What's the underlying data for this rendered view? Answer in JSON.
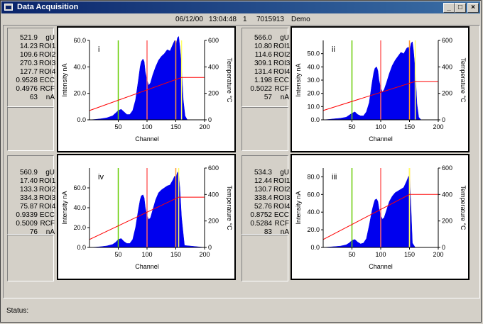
{
  "window": {
    "title": "Data Acquisition",
    "min": "_",
    "max": "□",
    "close": "×"
  },
  "infobar": {
    "date": "06/12/00",
    "time": "13:04:48",
    "index": "1",
    "sample_id": "7015913",
    "mode": "Demo"
  },
  "status": {
    "label": "Status:"
  },
  "panels": [
    {
      "stats": [
        [
          "521.9",
          "gU"
        ],
        [
          "14.23",
          "ROI1"
        ],
        [
          "109.6",
          "ROI2"
        ],
        [
          "270.3",
          "ROI3"
        ],
        [
          "127.7",
          "ROI4"
        ],
        [
          "0.9528",
          "ECC"
        ],
        [
          "0.4976",
          "RCF"
        ],
        [
          "63",
          "nA"
        ]
      ]
    },
    {
      "stats": [
        [
          "566.0",
          "gU"
        ],
        [
          "10.80",
          "ROI1"
        ],
        [
          "114.6",
          "ROI2"
        ],
        [
          "309.1",
          "ROI3"
        ],
        [
          "131.4",
          "ROI4"
        ],
        [
          "1.198",
          "ECC"
        ],
        [
          "0.5022",
          "RCF"
        ],
        [
          "57",
          "nA"
        ]
      ]
    },
    {
      "stats": [
        [
          "560.9",
          "gU"
        ],
        [
          "17.40",
          "ROI1"
        ],
        [
          "133.3",
          "ROI2"
        ],
        [
          "334.3",
          "ROI3"
        ],
        [
          "75.87",
          "ROI4"
        ],
        [
          "0.9339",
          "ECC"
        ],
        [
          "0.5009",
          "RCF"
        ],
        [
          "76",
          "nA"
        ]
      ]
    },
    {
      "stats": [
        [
          "534.3",
          "gU"
        ],
        [
          "12.44",
          "ROI1"
        ],
        [
          "130.7",
          "ROI2"
        ],
        [
          "338.4",
          "ROI3"
        ],
        [
          "52.76",
          "ROI4"
        ],
        [
          "0.8752",
          "ECC"
        ],
        [
          "0.5284",
          "RCF"
        ],
        [
          "83",
          "nA"
        ]
      ]
    }
  ],
  "chart_data": [
    {
      "type": "area",
      "label": "i",
      "xlabel": "Channel",
      "ylabel": "Intensity nA",
      "y2label": "Temperature °C",
      "xlim": [
        0,
        200
      ],
      "ylim": [
        0,
        60
      ],
      "y2lim": [
        0,
        600
      ],
      "xticks": [
        "50",
        "100",
        "150",
        "200"
      ],
      "yticks": [
        "0.0",
        "20.0",
        "40.0",
        "60.0"
      ],
      "y2ticks": [
        "0",
        "200",
        "400",
        "600"
      ],
      "markers": [
        {
          "x": 50,
          "color": "#66cc00"
        },
        {
          "x": 100,
          "color": "#ff6666"
        },
        {
          "x": 150,
          "color": "#ff9933"
        },
        {
          "x": 160,
          "color": "#ffff66"
        }
      ],
      "x": [
        0,
        10,
        20,
        30,
        40,
        45,
        50,
        55,
        60,
        65,
        70,
        75,
        80,
        85,
        88,
        90,
        93,
        95,
        97,
        100,
        103,
        106,
        110,
        115,
        120,
        125,
        130,
        135,
        140,
        145,
        148,
        150,
        153,
        155,
        157,
        160,
        163,
        166,
        170,
        200
      ],
      "y": [
        0,
        0.3,
        0.8,
        1.5,
        3,
        5,
        7,
        8,
        6,
        4,
        4,
        7,
        15,
        30,
        40,
        44,
        46,
        44,
        36,
        30,
        26,
        28,
        34,
        40,
        45,
        48,
        50,
        53,
        52,
        57,
        60,
        56,
        62,
        63,
        55,
        40,
        15,
        3,
        0,
        0
      ],
      "temperature": {
        "x": [
          0,
          160,
          200
        ],
        "y": [
          70,
          320,
          320
        ]
      }
    },
    {
      "type": "area",
      "label": "ii",
      "xlabel": "Channel",
      "ylabel": "Intensity nA",
      "y2label": "Temperature °C",
      "xlim": [
        0,
        200
      ],
      "ylim": [
        0,
        60
      ],
      "y2lim": [
        0,
        600
      ],
      "xticks": [
        "50",
        "100",
        "150",
        "200"
      ],
      "yticks": [
        "0.0",
        "10.0",
        "20.0",
        "30.0",
        "40.0",
        "50.0"
      ],
      "y2ticks": [
        "0",
        "200",
        "400",
        "600"
      ],
      "markers": [
        {
          "x": 50,
          "color": "#66cc00"
        },
        {
          "x": 100,
          "color": "#ff6666"
        },
        {
          "x": 150,
          "color": "#ff9933"
        },
        {
          "x": 160,
          "color": "#ffff66"
        }
      ],
      "x": [
        0,
        10,
        20,
        30,
        40,
        45,
        50,
        55,
        60,
        65,
        70,
        75,
        80,
        85,
        88,
        90,
        93,
        95,
        97,
        100,
        103,
        106,
        110,
        115,
        120,
        125,
        130,
        135,
        140,
        145,
        148,
        150,
        153,
        155,
        157,
        160,
        163,
        166,
        170,
        200
      ],
      "y": [
        0,
        0.3,
        0.8,
        1.2,
        2,
        3.5,
        5,
        6,
        4,
        3,
        3,
        6,
        13,
        28,
        36,
        39,
        40,
        37,
        30,
        24,
        21,
        23,
        28,
        35,
        41,
        45,
        48,
        51,
        50,
        54,
        55,
        52,
        58,
        59,
        52,
        37,
        12,
        2,
        0,
        0
      ],
      "temperature": {
        "x": [
          0,
          160,
          200
        ],
        "y": [
          70,
          290,
          290
        ]
      }
    },
    {
      "type": "area",
      "label": "iv",
      "xlabel": "Channel",
      "ylabel": "Intensity nA",
      "y2label": "Temperature °C",
      "xlim": [
        0,
        200
      ],
      "ylim": [
        0,
        80
      ],
      "y2lim": [
        0,
        600
      ],
      "xticks": [
        "50",
        "100",
        "150",
        "200"
      ],
      "yticks": [
        "0.0",
        "20.0",
        "40.0",
        "60.0"
      ],
      "y2ticks": [
        "0",
        "200",
        "400",
        "600"
      ],
      "markers": [
        {
          "x": 50,
          "color": "#66cc00"
        },
        {
          "x": 100,
          "color": "#ff6666"
        },
        {
          "x": 150,
          "color": "#ff9933"
        },
        {
          "x": 155,
          "color": "#ffff66"
        }
      ],
      "x": [
        0,
        10,
        20,
        30,
        40,
        45,
        50,
        55,
        60,
        65,
        70,
        75,
        80,
        85,
        88,
        90,
        93,
        95,
        97,
        100,
        103,
        106,
        110,
        115,
        120,
        125,
        130,
        135,
        140,
        145,
        148,
        150,
        153,
        155,
        157,
        160,
        165,
        200
      ],
      "y": [
        0,
        0.3,
        0.8,
        1.5,
        3,
        5,
        8,
        9,
        6,
        4,
        4,
        8,
        20,
        38,
        48,
        52,
        53,
        50,
        40,
        32,
        28,
        30,
        38,
        48,
        55,
        58,
        60,
        62,
        63,
        68,
        72,
        70,
        76,
        74,
        60,
        30,
        2,
        0
      ],
      "temperature": {
        "x": [
          0,
          155,
          200
        ],
        "y": [
          60,
          380,
          380
        ]
      }
    },
    {
      "type": "area",
      "label": "iii",
      "xlabel": "Channel",
      "ylabel": "Intensity nA",
      "y2label": "Temperature °C",
      "xlim": [
        0,
        200
      ],
      "ylim": [
        0,
        90
      ],
      "y2lim": [
        0,
        600
      ],
      "xticks": [
        "50",
        "100",
        "150",
        "200"
      ],
      "yticks": [
        "0.0",
        "20.0",
        "40.0",
        "60.0",
        "80.0"
      ],
      "y2ticks": [
        "0",
        "200",
        "400",
        "600"
      ],
      "markers": [
        {
          "x": 50,
          "color": "#66cc00"
        },
        {
          "x": 100,
          "color": "#ff6666"
        },
        {
          "x": 150,
          "color": "#ff9933"
        },
        {
          "x": 150,
          "color": "#ffff66"
        }
      ],
      "x": [
        0,
        10,
        20,
        30,
        40,
        45,
        50,
        55,
        60,
        65,
        70,
        75,
        80,
        85,
        88,
        90,
        93,
        95,
        97,
        100,
        103,
        106,
        110,
        115,
        120,
        125,
        130,
        135,
        140,
        145,
        148,
        150,
        153,
        155,
        160,
        200
      ],
      "y": [
        0,
        0.5,
        1,
        1.5,
        3,
        5,
        8,
        9,
        6,
        4,
        5,
        10,
        25,
        42,
        50,
        54,
        55,
        52,
        44,
        36,
        32,
        34,
        42,
        52,
        58,
        62,
        64,
        66,
        68,
        75,
        80,
        82,
        40,
        5,
        0,
        0
      ],
      "temperature": {
        "x": [
          0,
          150,
          200
        ],
        "y": [
          60,
          400,
          400
        ]
      }
    }
  ]
}
